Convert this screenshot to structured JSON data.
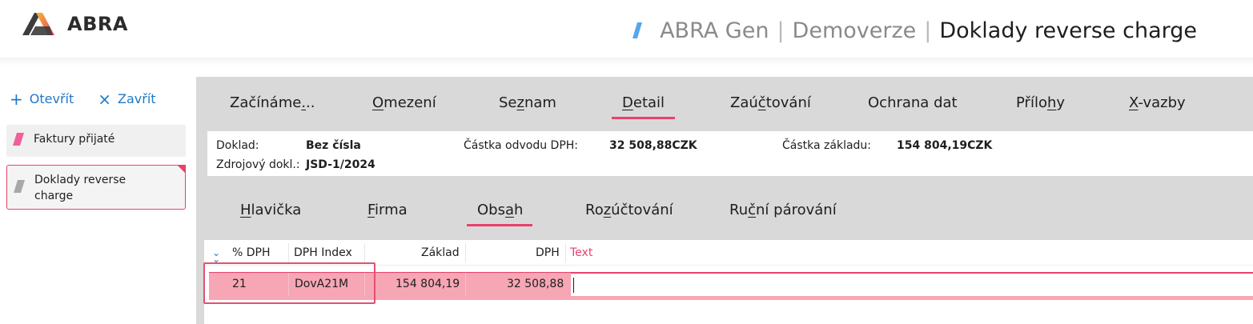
{
  "header": {
    "logo_text": "ABRA",
    "title_app": "ABRA Gen",
    "title_edition": "Demoverze",
    "title_module": "Doklady reverse charge",
    "separator": "|"
  },
  "sidebar": {
    "open_icon": "+",
    "open_label": "Otevřít",
    "close_icon": "×",
    "close_label": "Zavřít",
    "items": [
      {
        "label": "Faktury přijaté",
        "tag_color": "#f0609a"
      },
      {
        "label": "Doklady reverse",
        "label2": "charge",
        "tag_color": "#a8a8a8"
      }
    ]
  },
  "tabs": [
    {
      "pre": "Začínáme",
      "u": ".",
      "post": ".."
    },
    {
      "pre": "",
      "u": "O",
      "post": "mezení"
    },
    {
      "pre": "Se",
      "u": "z",
      "post": "nam"
    },
    {
      "pre": "",
      "u": "D",
      "post": "etail"
    },
    {
      "pre": "Zaú",
      "u": "č",
      "post": "tování"
    },
    {
      "pre": "Ochrana dat",
      "u": "",
      "post": ""
    },
    {
      "pre": "Přílo",
      "u": "h",
      "post": "y"
    },
    {
      "pre": "",
      "u": "X",
      "post": "-vazby"
    }
  ],
  "active_tab": "Detail",
  "info": {
    "doklad_label": "Doklad:",
    "doklad_value": "Bez čísla",
    "zdroj_label": "Zdrojový dokl.:",
    "zdroj_value": "JSD-1/2024",
    "castka_dph_label": "Částka odvodu DPH:",
    "castka_dph_value": "32 508,88CZK",
    "castka_zakl_label": "Částka základu:",
    "castka_zakl_value": "154 804,19CZK"
  },
  "subtabs": [
    {
      "pre": "",
      "u": "H",
      "post": "lavička"
    },
    {
      "pre": "",
      "u": "F",
      "post": "irma"
    },
    {
      "pre": "Obs",
      "u": "a",
      "post": "h"
    },
    {
      "pre": "Ro",
      "u": "z",
      "post": "účtování"
    },
    {
      "pre": "Ru",
      "u": "č",
      "post": "ní párování"
    }
  ],
  "active_subtab": "Obsah",
  "grid": {
    "columns": [
      "% DPH",
      "DPH Index",
      "Základ",
      "DPH",
      "Text"
    ],
    "rows": [
      {
        "dph_pct": "21",
        "dph_index": "DovA21M",
        "zaklad": "154 804,19",
        "dph": "32 508,88",
        "text": ""
      }
    ]
  },
  "colors": {
    "accent": "#e8416a",
    "link": "#1f78c8",
    "row_selected": "#f6a6b4",
    "panel": "#d9d9d9"
  }
}
